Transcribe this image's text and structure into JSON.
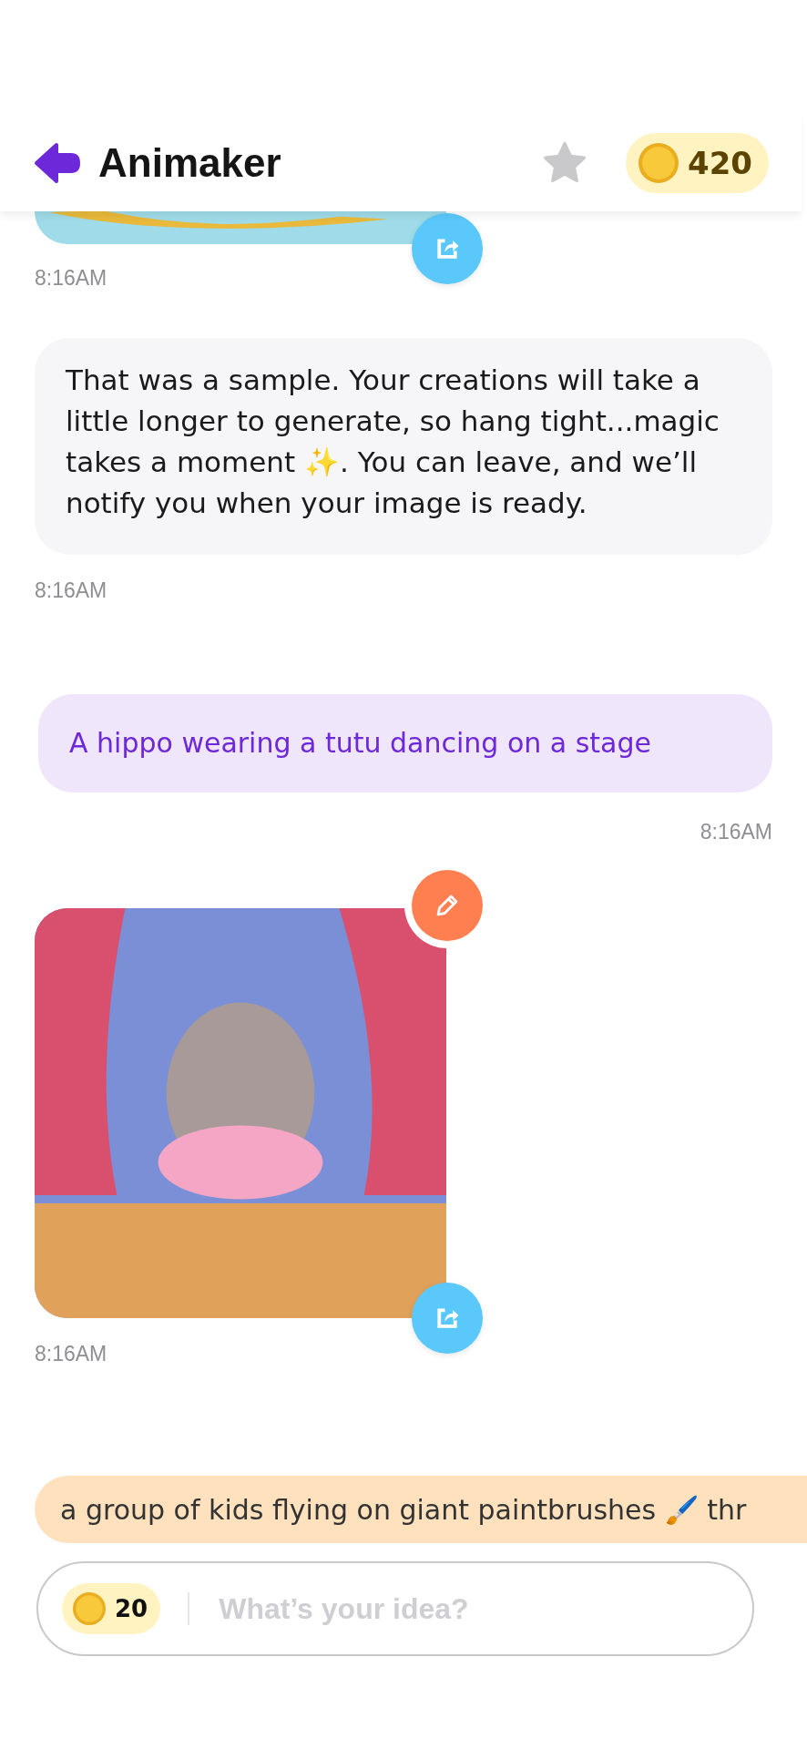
{
  "header": {
    "title": "Animaker",
    "coins": "420"
  },
  "messages": [
    {
      "kind": "partial-image",
      "time": "8:16AM"
    },
    {
      "kind": "bot",
      "text": "That was a sample. Your creations will take a little longer to generate, so hang tight...magic takes a moment ✨. You can leave, and we’ll notify you when your image is ready.",
      "time": "8:16AM"
    },
    {
      "kind": "user",
      "text": "A hippo wearing a tutu dancing on a stage",
      "time": "8:16AM"
    },
    {
      "kind": "image",
      "time": "8:16AM",
      "editable": true
    }
  ],
  "suggestion": "a group of kids flying on giant paintbrushes 🖌️ thr",
  "composer": {
    "cost": "20",
    "placeholder": "What’s your idea?"
  }
}
